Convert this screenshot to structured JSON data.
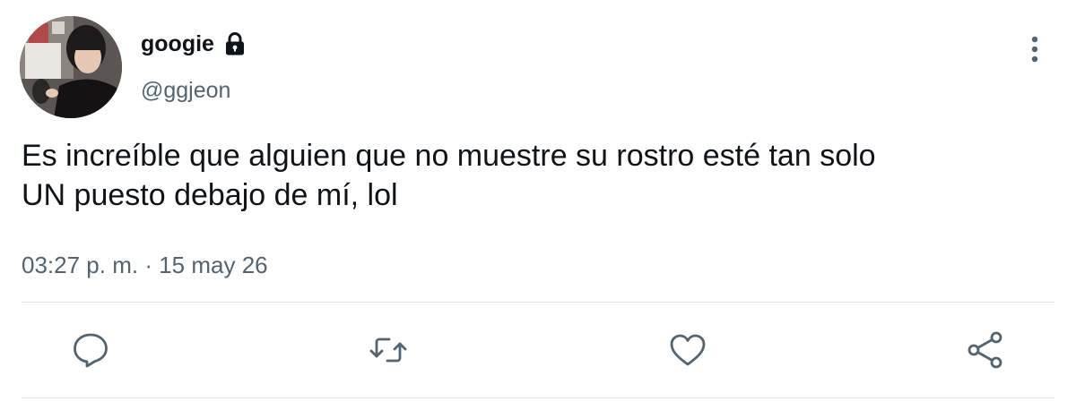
{
  "tweet": {
    "display_name": "googie",
    "handle": "@ggjeon",
    "text_line_1": "Es increíble que alguien que no muestre su rostro esté tan solo",
    "text_line_2": "UN puesto debajo de mí, lol",
    "time": "03:27 p. m.",
    "separator": "·",
    "date": "15 may 26",
    "protected_icon": "lock-icon",
    "menu_icon": "more-vertical-icon"
  },
  "actions": [
    {
      "name": "reply",
      "icon": "reply-icon"
    },
    {
      "name": "retweet",
      "icon": "retweet-icon"
    },
    {
      "name": "like",
      "icon": "heart-icon"
    },
    {
      "name": "share",
      "icon": "share-icon"
    }
  ],
  "colors": {
    "text_primary": "#0f1419",
    "text_secondary": "#536471",
    "divider": "#dfe3e7",
    "background": "#ffffff"
  }
}
